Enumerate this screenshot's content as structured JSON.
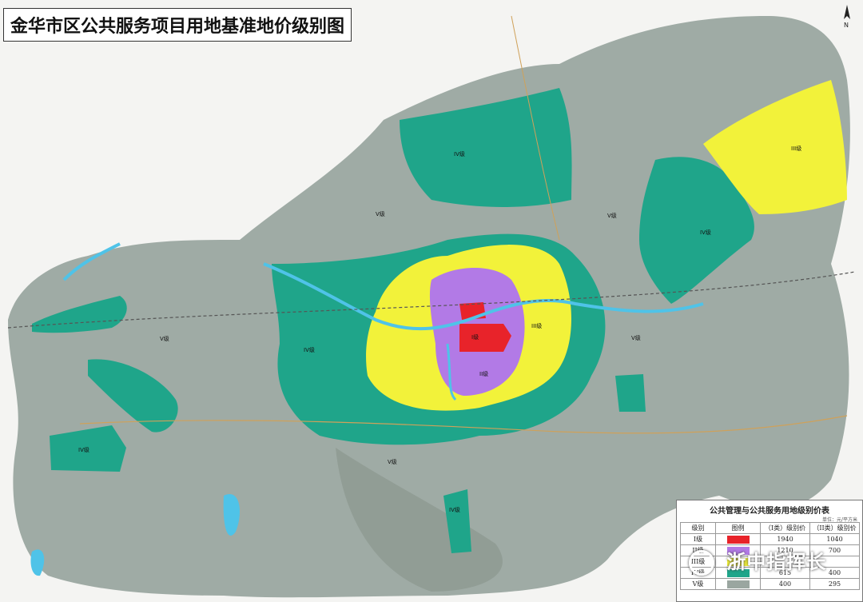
{
  "title": "金华市区公共服务项目用地基准地价级别图",
  "north_label": "N",
  "legend": {
    "title": "公共管理与公共服务用地级别价表",
    "unit": "单位：元/平方米",
    "headers": [
      "级别",
      "图例",
      "（I类）级别价",
      "（II类）级别价"
    ],
    "rows": [
      {
        "grade": "I级",
        "color": "#e8232a",
        "class1": "1940",
        "class2": "1040"
      },
      {
        "grade": "II级",
        "color": "#b27ae6",
        "class1": "1210",
        "class2": "700"
      },
      {
        "grade": "III级",
        "color": "#f2f23a",
        "class1": "",
        "class2": ""
      },
      {
        "grade": "IV级",
        "color": "#1fa58a",
        "class1": "615",
        "class2": "400"
      },
      {
        "grade": "V级",
        "color": "#9aa6a0",
        "class1": "400",
        "class2": "295"
      }
    ]
  },
  "grade_labels": {
    "I": "I级",
    "II": "II级",
    "III": "III级",
    "IV": "IV级",
    "V": "V级"
  },
  "watermark": "浙中指挥长",
  "colors": {
    "grade1": "#e8232a",
    "grade2": "#b27ae6",
    "grade3": "#f2f23a",
    "grade4": "#1fa58a",
    "grade5": "#9aa6a0",
    "water": "#4fc3e8",
    "background": "#f4f4f2"
  }
}
